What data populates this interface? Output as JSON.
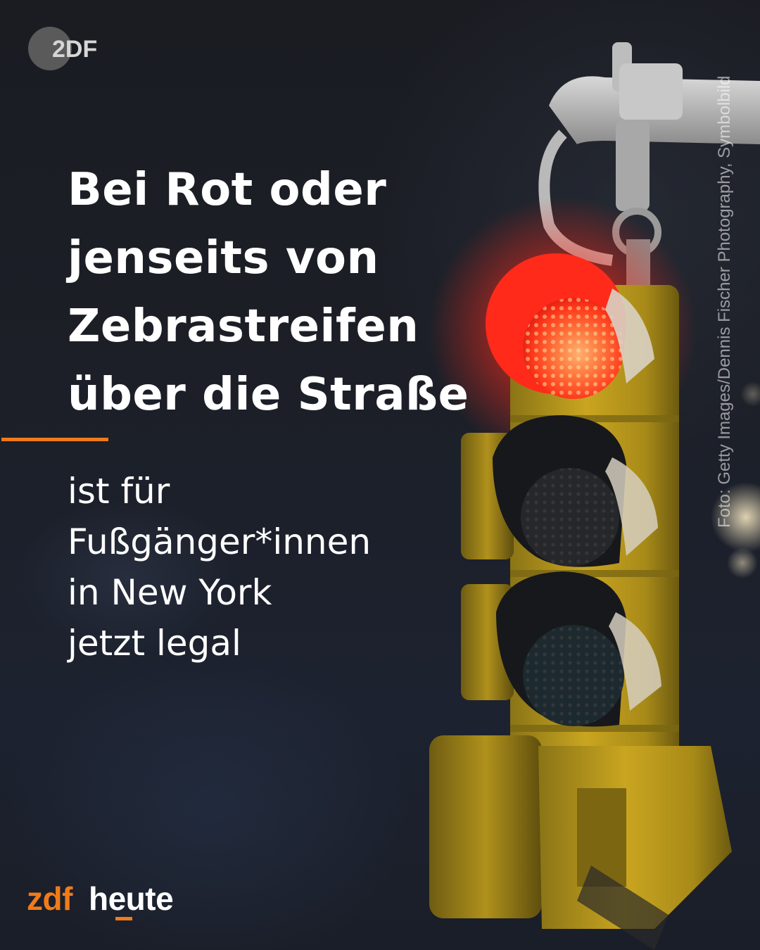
{
  "brand": {
    "logo_text": "2DF",
    "wordmark_zdf": "zdf",
    "wordmark_heute": "heute",
    "accent_color": "#f07b1b"
  },
  "headline": {
    "lines": [
      "Bei Rot oder",
      "jenseits von",
      "Zebrastreifen",
      "über die Straße"
    ]
  },
  "subline": {
    "lines": [
      "ist für",
      "Fußgänger*innen",
      "in New York",
      "jetzt legal"
    ]
  },
  "credit": "Foto: Getty Images/Dennis Fischer Photography, Symbolbild",
  "image": {
    "subject": "traffic-light-red",
    "colors": {
      "signal_red": "#ff2a1a",
      "housing": "#d8b020",
      "background": "#1a1c22"
    }
  }
}
